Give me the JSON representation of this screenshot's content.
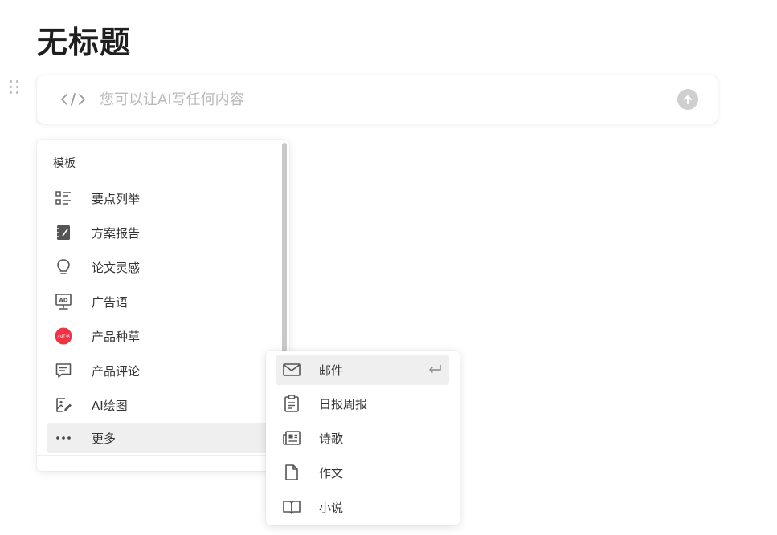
{
  "page": {
    "title": "无标题"
  },
  "ai_bar": {
    "code_icon": "code-icon",
    "placeholder": "您可以让AI写任何内容",
    "send_icon": "arrow-up-icon"
  },
  "template_panel": {
    "heading": "模板",
    "items": [
      {
        "label": "要点列举",
        "icon": "list-icon"
      },
      {
        "label": "方案报告",
        "icon": "notebook-icon"
      },
      {
        "label": "论文灵感",
        "icon": "lightbulb-icon"
      },
      {
        "label": "广告语",
        "icon": "ad-board-icon"
      },
      {
        "label": "产品种草",
        "icon": "xiaohongshu-icon"
      },
      {
        "label": "产品评论",
        "icon": "comment-icon"
      },
      {
        "label": "AI绘图",
        "icon": "image-edit-icon"
      },
      {
        "label": "更多",
        "icon": "more-icon"
      }
    ],
    "xiaohongshu_logo_text": "小红书"
  },
  "sub_menu": {
    "items": [
      {
        "label": "邮件",
        "icon": "mail-icon",
        "shortcut_icon": "enter-icon"
      },
      {
        "label": "日报周报",
        "icon": "clipboard-icon"
      },
      {
        "label": "诗歌",
        "icon": "newspaper-icon"
      },
      {
        "label": "作文",
        "icon": "document-icon"
      },
      {
        "label": "小说",
        "icon": "book-icon"
      }
    ]
  },
  "colors": {
    "xiaohongshu_red": "#ee3344",
    "icon_gray": "#555555",
    "placeholder_gray": "#b9b9b9",
    "hover_bg": "#efefef"
  }
}
